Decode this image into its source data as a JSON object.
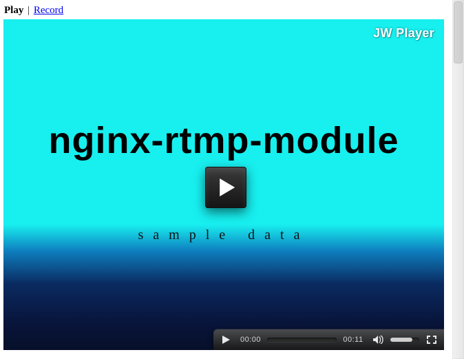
{
  "topbar": {
    "play_label": "Play",
    "separator": "|",
    "record_label": "Record"
  },
  "player": {
    "watermark": "JW Player",
    "poster_title": "nginx-rtmp-module",
    "poster_subtitle": "sample data"
  },
  "controls": {
    "elapsed": "00:00",
    "duration": "00:11"
  },
  "icons": {
    "big_play": "play-icon",
    "play_small": "play-icon",
    "mute": "speaker-icon",
    "fullscreen": "fullscreen-icon"
  }
}
